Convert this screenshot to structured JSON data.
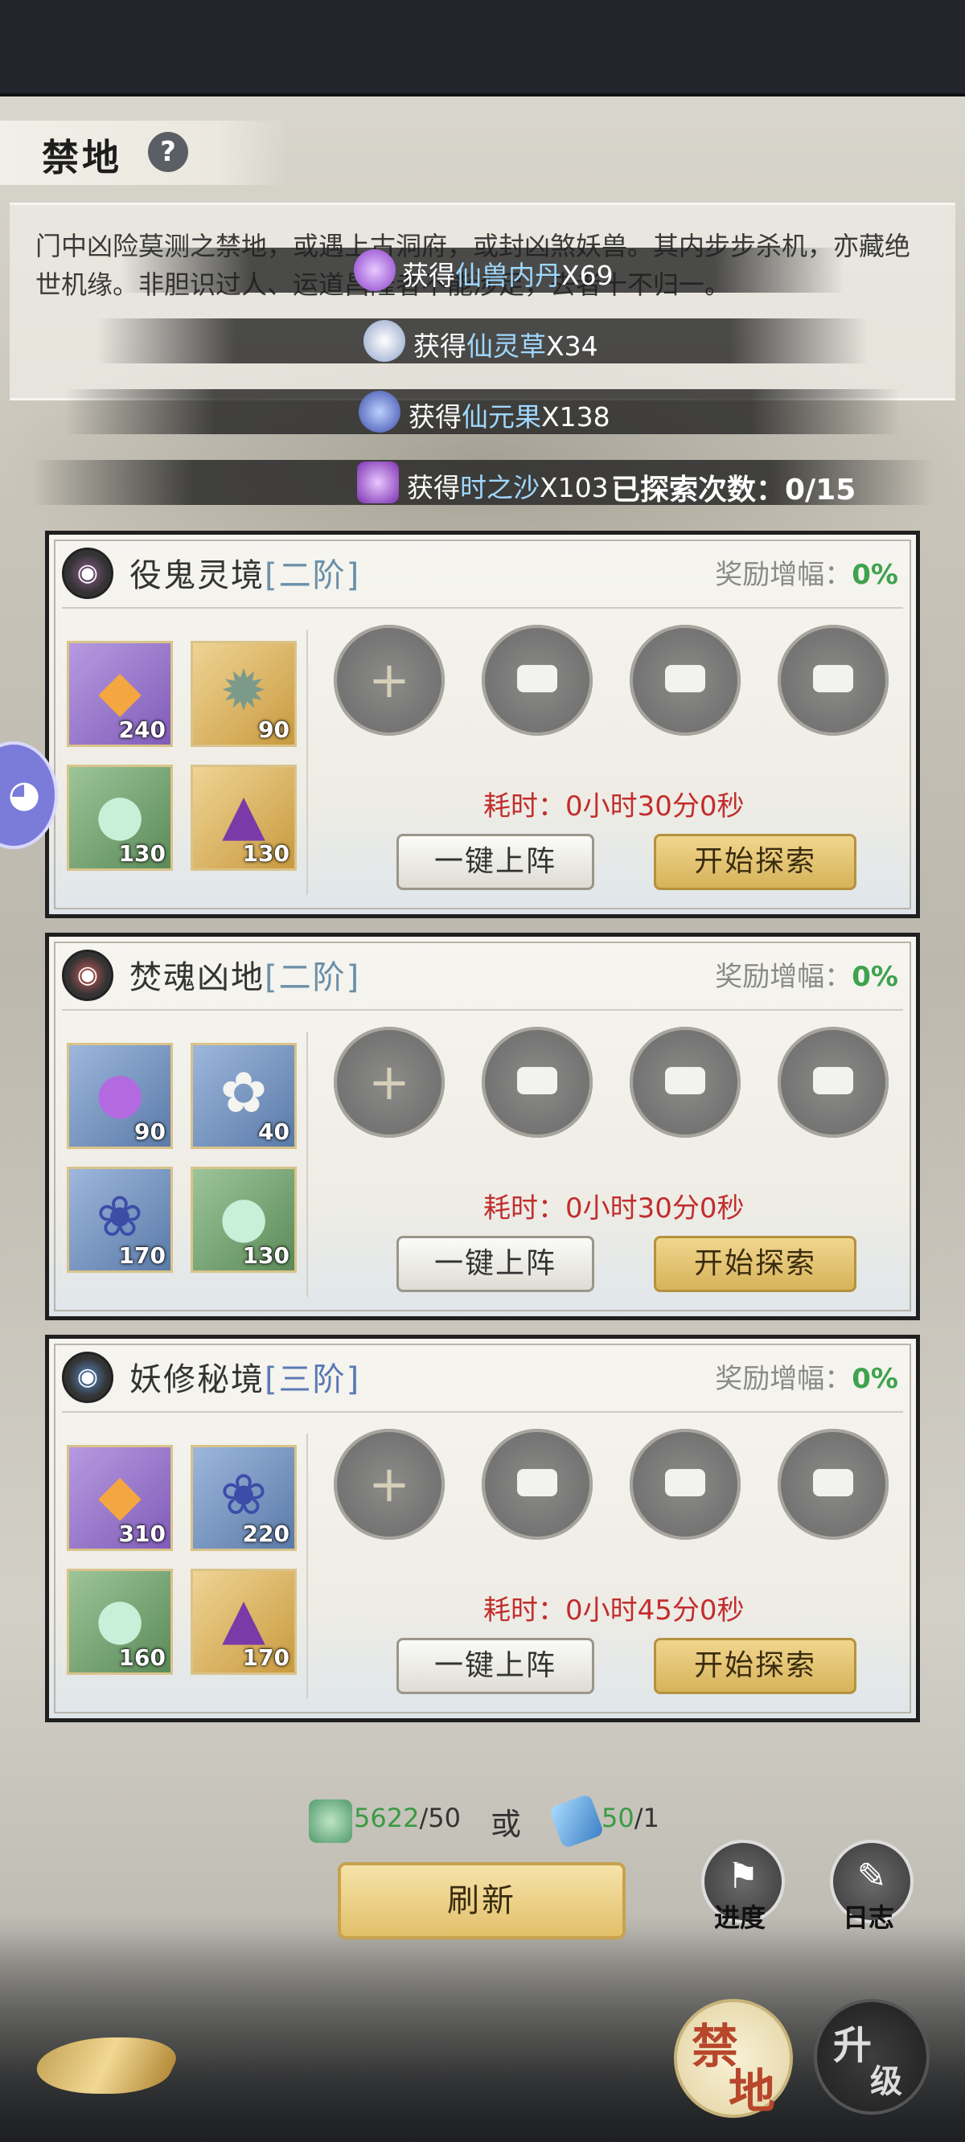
{
  "header": {
    "title": "禁地",
    "help": "?"
  },
  "description": "门中凶险莫测之禁地，或遇上古洞府，或封凶煞妖兽。其内步步杀机，亦藏绝世机缘。非胆识过人、运道昌隆者不能涉足，去者十不归一。",
  "rewards": [
    {
      "prefix": "获得",
      "item": "仙兽内丹",
      "qty": "X69"
    },
    {
      "prefix": "获得",
      "item": "仙灵草",
      "qty": "X34"
    },
    {
      "prefix": "获得",
      "item": "仙元果",
      "qty": "X138"
    },
    {
      "prefix": "获得",
      "item": "时之沙",
      "qty": "X103"
    }
  ],
  "explore_count": "已探索次数：0/15",
  "cards": [
    {
      "name": "役鬼灵境",
      "tier": "[二阶]",
      "bonus_label": "奖励增幅：",
      "bonus_value": "0%",
      "materials": [
        {
          "count": "240",
          "color": "#9b74c9",
          "icon": "amber-crystal-icon"
        },
        {
          "count": "90",
          "color": "#d9b25f",
          "icon": "beast-pelt-icon"
        },
        {
          "count": "130",
          "color": "#6f9c6a",
          "icon": "gourd-icon"
        },
        {
          "count": "130",
          "color": "#d9b25f",
          "icon": "sand-box-icon"
        }
      ],
      "time": "耗时：0小时30分0秒",
      "deploy_label": "一键上阵",
      "start_label": "开始探索"
    },
    {
      "name": "焚魂凶地",
      "tier": "[二阶]",
      "bonus_label": "奖励增幅：",
      "bonus_value": "0%",
      "materials": [
        {
          "count": "90",
          "color": "#6f8fb5",
          "icon": "spirit-orb-icon"
        },
        {
          "count": "40",
          "color": "#6f8fb5",
          "icon": "spirit-flower-icon"
        },
        {
          "count": "170",
          "color": "#6f8fb5",
          "icon": "berry-icon"
        },
        {
          "count": "130",
          "color": "#6f9c6a",
          "icon": "gourd-icon"
        }
      ],
      "time": "耗时：0小时30分0秒",
      "deploy_label": "一键上阵",
      "start_label": "开始探索"
    },
    {
      "name": "妖修秘境",
      "tier": "[三阶]",
      "bonus_label": "奖励增幅：",
      "bonus_value": "0%",
      "materials": [
        {
          "count": "310",
          "color": "#9b74c9",
          "icon": "amber-crystal-icon"
        },
        {
          "count": "220",
          "color": "#6f8fb5",
          "icon": "berry-icon"
        },
        {
          "count": "160",
          "color": "#6f9c6a",
          "icon": "gourd-icon"
        },
        {
          "count": "170",
          "color": "#d9b25f",
          "icon": "sand-box-icon"
        }
      ],
      "time": "耗时：0小时45分0秒",
      "deploy_label": "一键上阵",
      "start_label": "开始探索"
    }
  ],
  "cost": {
    "jade_have": "5622",
    "jade_need": "/50",
    "or": "或",
    "ticket_have": "50",
    "ticket_need": "/1"
  },
  "buttons": {
    "refresh": "刷新",
    "progress": "进度",
    "log": "日志"
  },
  "bottom_tabs": {
    "forbidden_a": "禁",
    "forbidden_b": "地",
    "upgrade_a": "升",
    "upgrade_b": "级"
  }
}
